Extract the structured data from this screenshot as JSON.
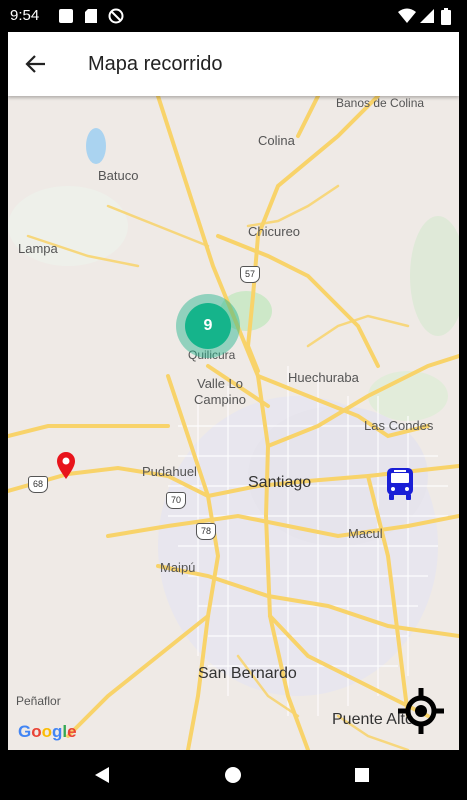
{
  "status_bar": {
    "time": "9:54",
    "icons": [
      "square-notification-icon",
      "sd-card-icon",
      "do-not-disturb-icon",
      "wifi-icon",
      "signal-icon",
      "battery-icon"
    ]
  },
  "app_bar": {
    "back_icon": "arrow-left-icon",
    "title": "Mapa recorrido"
  },
  "map": {
    "places": {
      "banos_de_colina": "Banos de\nColina",
      "colina": "Colina",
      "batuco": "Batuco",
      "chicureo": "Chicureo",
      "lampa": "Lampa",
      "quilicura": "Quilicura",
      "huechuraba": "Huechuraba",
      "valle_lo_campino": "Valle Lo\nCampino",
      "las_condes": "Las Condes",
      "pudahuel": "Pudahuel",
      "santiago": "Santiago",
      "macul": "Macul",
      "maipu": "Maipú",
      "san_bernardo": "San Bernardo",
      "penaflor": "Peñaflor",
      "puente_alto": "Puente Alto"
    },
    "route_shields": {
      "r57": "57",
      "r68": "68",
      "r70": "70",
      "r78": "78"
    },
    "cluster_count": "9",
    "attribution": "Google",
    "markers": {
      "location_pin": "map-pin-icon",
      "bus": "bus-icon",
      "my_location": "crosshair-icon"
    },
    "colors": {
      "road": "#f8d36a",
      "land": "#efeae6",
      "park": "#cde8c8",
      "water": "#aad3f0",
      "cluster": "#15b48b",
      "pin": "#e8141c",
      "bus": "#1a1fd6"
    }
  },
  "nav_bar": {
    "back": "triangle-back-icon",
    "home": "circle-home-icon",
    "recents": "square-recents-icon"
  }
}
